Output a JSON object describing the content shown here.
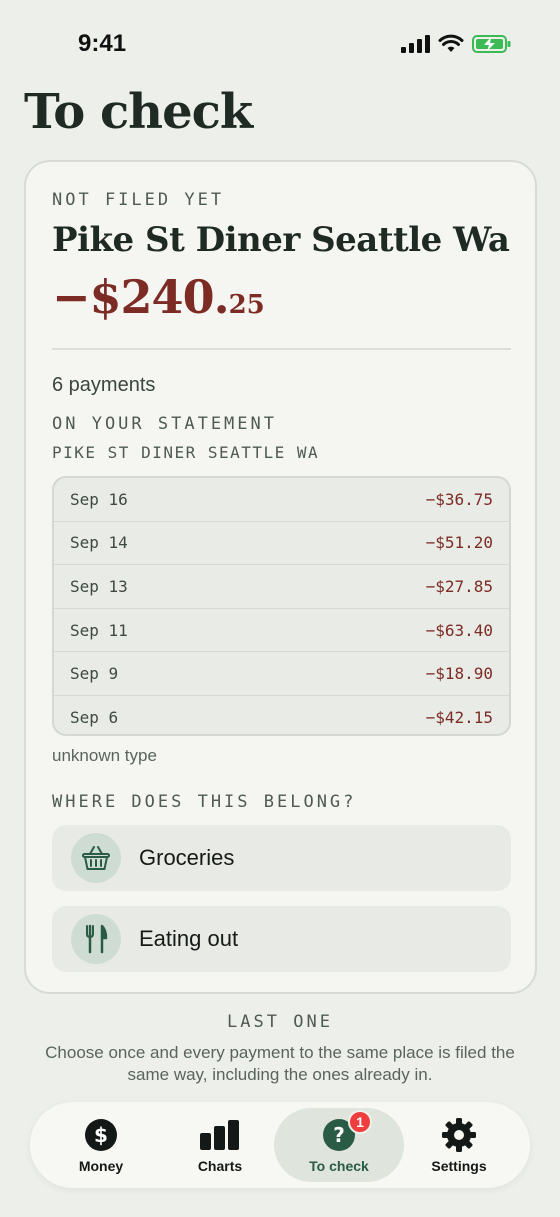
{
  "status_bar": {
    "time": "9:41"
  },
  "page": {
    "title": "To check"
  },
  "card": {
    "eyebrow": "NOT FILED YET",
    "merchant": "Pike St Diner Seattle Wa",
    "amount_main": "−$240.",
    "amount_cents": "25",
    "payments_count": "6 payments",
    "on_statement_label": "ON YOUR STATEMENT",
    "statement_name": "PIKE ST DINER SEATTLE WA",
    "transactions": [
      {
        "date": "Sep 16",
        "amount": "−$36.75"
      },
      {
        "date": "Sep 14",
        "amount": "−$51.20"
      },
      {
        "date": "Sep 13",
        "amount": "−$27.85"
      },
      {
        "date": "Sep 11",
        "amount": "−$63.40"
      },
      {
        "date": "Sep 9",
        "amount": "−$18.90"
      },
      {
        "date": "Sep 6",
        "amount": "−$42.15"
      }
    ],
    "type_note": "unknown type",
    "where_heading": "WHERE DOES THIS BELONG?",
    "options": [
      {
        "label": "Groceries",
        "icon": "basket-icon"
      },
      {
        "label": "Eating out",
        "icon": "fork-knife-icon"
      }
    ]
  },
  "footer": {
    "last_one": "LAST ONE",
    "note": "Choose once and every payment to the same place is filed the same way, including the ones already in."
  },
  "tab_bar": {
    "tabs": [
      {
        "label": "Money",
        "icon": "dollar-icon"
      },
      {
        "label": "Charts",
        "icon": "bar-chart-icon"
      },
      {
        "label": "To check",
        "icon": "question-icon",
        "badge": "1",
        "selected": true
      },
      {
        "label": "Settings",
        "icon": "gear-icon"
      }
    ]
  },
  "colors": {
    "background": "#edefea",
    "negative_amount": "#7d2b25",
    "accent": "#2a5c45",
    "badge": "#ef3e3e"
  }
}
